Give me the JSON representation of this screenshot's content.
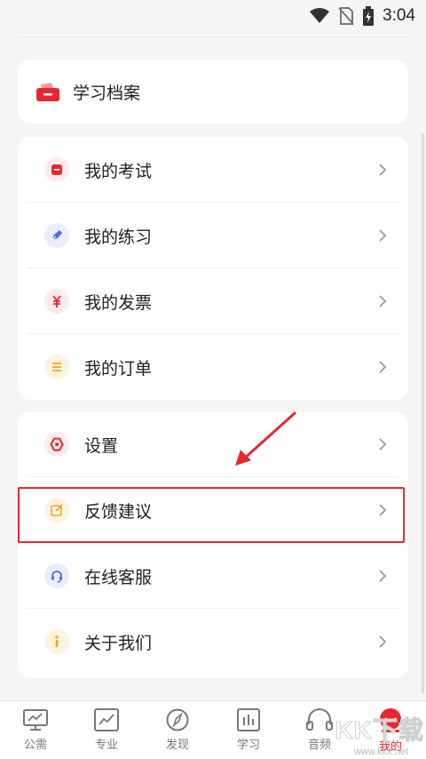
{
  "status_bar": {
    "time": "3:04"
  },
  "archive": {
    "label": "学习档案"
  },
  "group1": [
    {
      "label": "我的考试",
      "icon": "exam-icon",
      "color": "#e8262d",
      "bg": "#fdeaea"
    },
    {
      "label": "我的练习",
      "icon": "practice-icon",
      "color": "#4b6cf0",
      "bg": "#e9edfd"
    },
    {
      "label": "我的发票",
      "icon": "invoice-icon",
      "color": "#e8262d",
      "bg": "#fdeaea"
    },
    {
      "label": "我的订单",
      "icon": "order-icon",
      "color": "#f5a623",
      "bg": "#fef3e0"
    }
  ],
  "group2": [
    {
      "label": "设置",
      "icon": "settings-icon",
      "color": "#e8262d",
      "bg": "#fdeaea"
    },
    {
      "label": "反馈建议",
      "icon": "feedback-icon",
      "color": "#f5a623",
      "bg": "#fef3e0"
    },
    {
      "label": "在线客服",
      "icon": "customer-service-icon",
      "color": "#4b6cf0",
      "bg": "#e9edfd"
    },
    {
      "label": "关于我们",
      "icon": "about-icon",
      "color": "#f5a623",
      "bg": "#fef3e0"
    }
  ],
  "tabs": [
    {
      "label": "公需",
      "icon": "monitor-icon"
    },
    {
      "label": "专业",
      "icon": "chart-icon"
    },
    {
      "label": "发现",
      "icon": "compass-icon"
    },
    {
      "label": "学习",
      "icon": "study-icon"
    },
    {
      "label": "音频",
      "icon": "headphones-icon"
    },
    {
      "label": "我的",
      "icon": "profile-icon",
      "active": true
    }
  ],
  "watermark": {
    "text": "KK下载",
    "url": "www.kkx.net"
  },
  "colors": {
    "accent": "#e8262d",
    "background": "#f5f5f5"
  }
}
